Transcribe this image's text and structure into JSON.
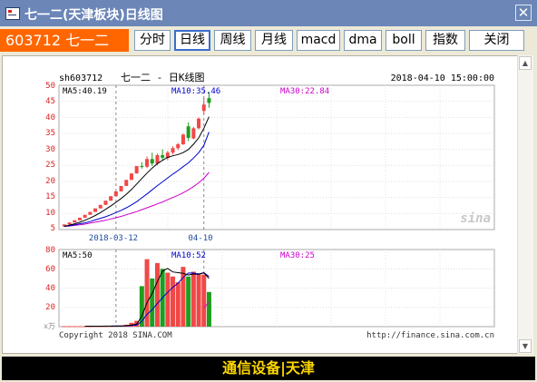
{
  "window": {
    "title": "七一二(天津板块)日线图",
    "close_label": "✕"
  },
  "toolbar": {
    "code_label": "603712 七一二",
    "buttons": [
      "分时",
      "日线",
      "周线",
      "月线",
      "macd",
      "dma",
      "boll",
      "指数",
      "关闭"
    ],
    "active": "日线"
  },
  "chart_header": {
    "symbol": "sh603712",
    "name": "七一二 - 日K线图",
    "datetime": "2018-04-10 15:00:00"
  },
  "ma_labels": {
    "ma5": "MA5:40.19",
    "ma10": "MA10:35.46",
    "ma30": "MA30:22.84"
  },
  "vol_labels": {
    "ma5": "MA5:50",
    "ma10": "MA10:52",
    "ma30": "MA30:25",
    "unit": "x万"
  },
  "watermark": "sina",
  "copyright": "Copyright 2018 SINA.COM",
  "url": "http://finance.sina.com.cn",
  "x_labels": [
    "2018-03-12",
    "04-10"
  ],
  "price_ticks": [
    "50",
    "45",
    "40",
    "35",
    "30",
    "25",
    "20",
    "15",
    "10",
    "5"
  ],
  "vol_ticks": [
    "80",
    "60",
    "40",
    "20"
  ],
  "footer_text": "通信设备|天津",
  "colors": {
    "up": "#f04848",
    "down": "#1e9e1e",
    "ma5": "#000000",
    "ma10": "#0000cc",
    "ma30": "#cc00cc",
    "header_accent": "#ff6600",
    "footer_text": "#ffd800"
  },
  "chart_data": {
    "type": "candlestick",
    "price_range": [
      5,
      50
    ],
    "volume_range": [
      0,
      80
    ],
    "candles": [
      {
        "o": 6.0,
        "h": 6.6,
        "l": 5.8,
        "c": 6.6,
        "v": 0.5
      },
      {
        "o": 6.6,
        "h": 7.2,
        "l": 6.6,
        "c": 7.2,
        "v": 0.5
      },
      {
        "o": 7.2,
        "h": 7.9,
        "l": 7.2,
        "c": 7.9,
        "v": 0.5
      },
      {
        "o": 7.9,
        "h": 8.7,
        "l": 7.9,
        "c": 8.7,
        "v": 0.5
      },
      {
        "o": 8.7,
        "h": 9.6,
        "l": 8.7,
        "c": 9.6,
        "v": 0.5
      },
      {
        "o": 9.6,
        "h": 10.5,
        "l": 9.6,
        "c": 10.5,
        "v": 0.5
      },
      {
        "o": 10.5,
        "h": 11.6,
        "l": 10.5,
        "c": 11.6,
        "v": 0.6
      },
      {
        "o": 11.6,
        "h": 12.7,
        "l": 11.6,
        "c": 12.7,
        "v": 0.6
      },
      {
        "o": 12.7,
        "h": 14.0,
        "l": 12.7,
        "c": 14.0,
        "v": 0.6
      },
      {
        "o": 14.0,
        "h": 15.4,
        "l": 14.0,
        "c": 15.4,
        "v": 0.7
      },
      {
        "o": 15.4,
        "h": 16.9,
        "l": 15.4,
        "c": 16.9,
        "v": 0.8
      },
      {
        "o": 16.9,
        "h": 18.6,
        "l": 16.9,
        "c": 18.6,
        "v": 1.0
      },
      {
        "o": 18.6,
        "h": 20.5,
        "l": 18.6,
        "c": 20.5,
        "v": 2.0
      },
      {
        "o": 20.5,
        "h": 22.5,
        "l": 20.5,
        "c": 22.5,
        "v": 4.0
      },
      {
        "o": 22.5,
        "h": 24.8,
        "l": 22.5,
        "c": 24.8,
        "v": 6.0
      },
      {
        "o": 24.8,
        "h": 26.0,
        "l": 24.0,
        "c": 24.6,
        "v": 42.0
      },
      {
        "o": 24.6,
        "h": 27.8,
        "l": 24.2,
        "c": 27.0,
        "v": 70.0
      },
      {
        "o": 27.0,
        "h": 29.0,
        "l": 24.8,
        "c": 25.6,
        "v": 50.0
      },
      {
        "o": 25.6,
        "h": 28.8,
        "l": 25.0,
        "c": 28.2,
        "v": 66.0
      },
      {
        "o": 28.2,
        "h": 30.0,
        "l": 26.8,
        "c": 27.4,
        "v": 60.0
      },
      {
        "o": 27.4,
        "h": 29.6,
        "l": 26.6,
        "c": 29.0,
        "v": 56.0
      },
      {
        "o": 29.0,
        "h": 31.0,
        "l": 28.4,
        "c": 30.4,
        "v": 52.0
      },
      {
        "o": 30.4,
        "h": 32.0,
        "l": 29.8,
        "c": 31.6,
        "v": 46.0
      },
      {
        "o": 31.6,
        "h": 35.0,
        "l": 31.4,
        "c": 34.6,
        "v": 62.0
      },
      {
        "o": 37.2,
        "h": 38.4,
        "l": 32.6,
        "c": 33.6,
        "v": 52.0
      },
      {
        "o": 33.4,
        "h": 37.0,
        "l": 33.2,
        "c": 36.6,
        "v": 57.0
      },
      {
        "o": 36.6,
        "h": 40.0,
        "l": 36.2,
        "c": 39.6,
        "v": 54.0
      },
      {
        "o": 42.0,
        "h": 46.0,
        "l": 41.0,
        "c": 44.0,
        "v": 54.0
      },
      {
        "o": 46.0,
        "h": 48.0,
        "l": 43.0,
        "c": 44.5,
        "v": 36.0
      }
    ],
    "ma5": [
      6.0,
      6.4,
      6.8,
      7.3,
      7.9,
      8.6,
      9.4,
      10.3,
      11.3,
      12.4,
      13.5,
      14.7,
      16.0,
      17.5,
      19.2,
      20.9,
      22.6,
      24.2,
      25.6,
      26.6,
      27.5,
      28.0,
      28.4,
      29.0,
      30.0,
      31.6,
      33.6,
      36.6,
      40.19
    ],
    "ma10": [
      6.0,
      6.2,
      6.5,
      6.8,
      7.1,
      7.5,
      8.0,
      8.5,
      9.0,
      9.6,
      10.3,
      11.0,
      11.8,
      12.7,
      13.7,
      14.9,
      16.1,
      17.4,
      18.7,
      19.9,
      21.1,
      22.3,
      23.4,
      24.6,
      25.8,
      27.3,
      29.0,
      31.3,
      35.46
    ],
    "ma30": [
      6.0,
      6.1,
      6.3,
      6.5,
      6.7,
      7.0,
      7.3,
      7.6,
      7.9,
      8.3,
      8.7,
      9.1,
      9.6,
      10.1,
      10.6,
      11.2,
      11.8,
      12.4,
      13.0,
      13.6,
      14.3,
      15.0,
      15.7,
      16.5,
      17.4,
      18.4,
      19.6,
      21.0,
      22.84
    ],
    "vol_ma5": [
      null,
      null,
      null,
      null,
      0.5,
      0.5,
      0.5,
      0.5,
      0.6,
      0.6,
      0.7,
      0.7,
      1.0,
      1.6,
      2.6,
      10.8,
      24.8,
      34.4,
      46.8,
      57.6,
      60.4,
      56.8,
      56.0,
      55.2,
      53.6,
      54.6,
      54.2,
      55.8,
      50.0
    ],
    "vol_ma10": [
      null,
      null,
      null,
      null,
      null,
      null,
      null,
      null,
      null,
      0.6,
      0.6,
      0.7,
      0.8,
      1.1,
      1.6,
      5.6,
      12.7,
      17.6,
      24.1,
      30.1,
      35.6,
      40.8,
      45.2,
      51.0,
      55.6,
      55.5,
      54.7,
      55.9,
      52.0
    ],
    "vol_ma30": [
      null,
      null,
      null,
      null,
      null,
      null,
      null,
      null,
      null,
      null,
      null,
      null,
      null,
      null,
      null,
      null,
      null,
      null,
      null,
      null,
      null,
      null,
      null,
      null,
      null,
      null,
      null,
      20.0,
      25.0
    ]
  }
}
